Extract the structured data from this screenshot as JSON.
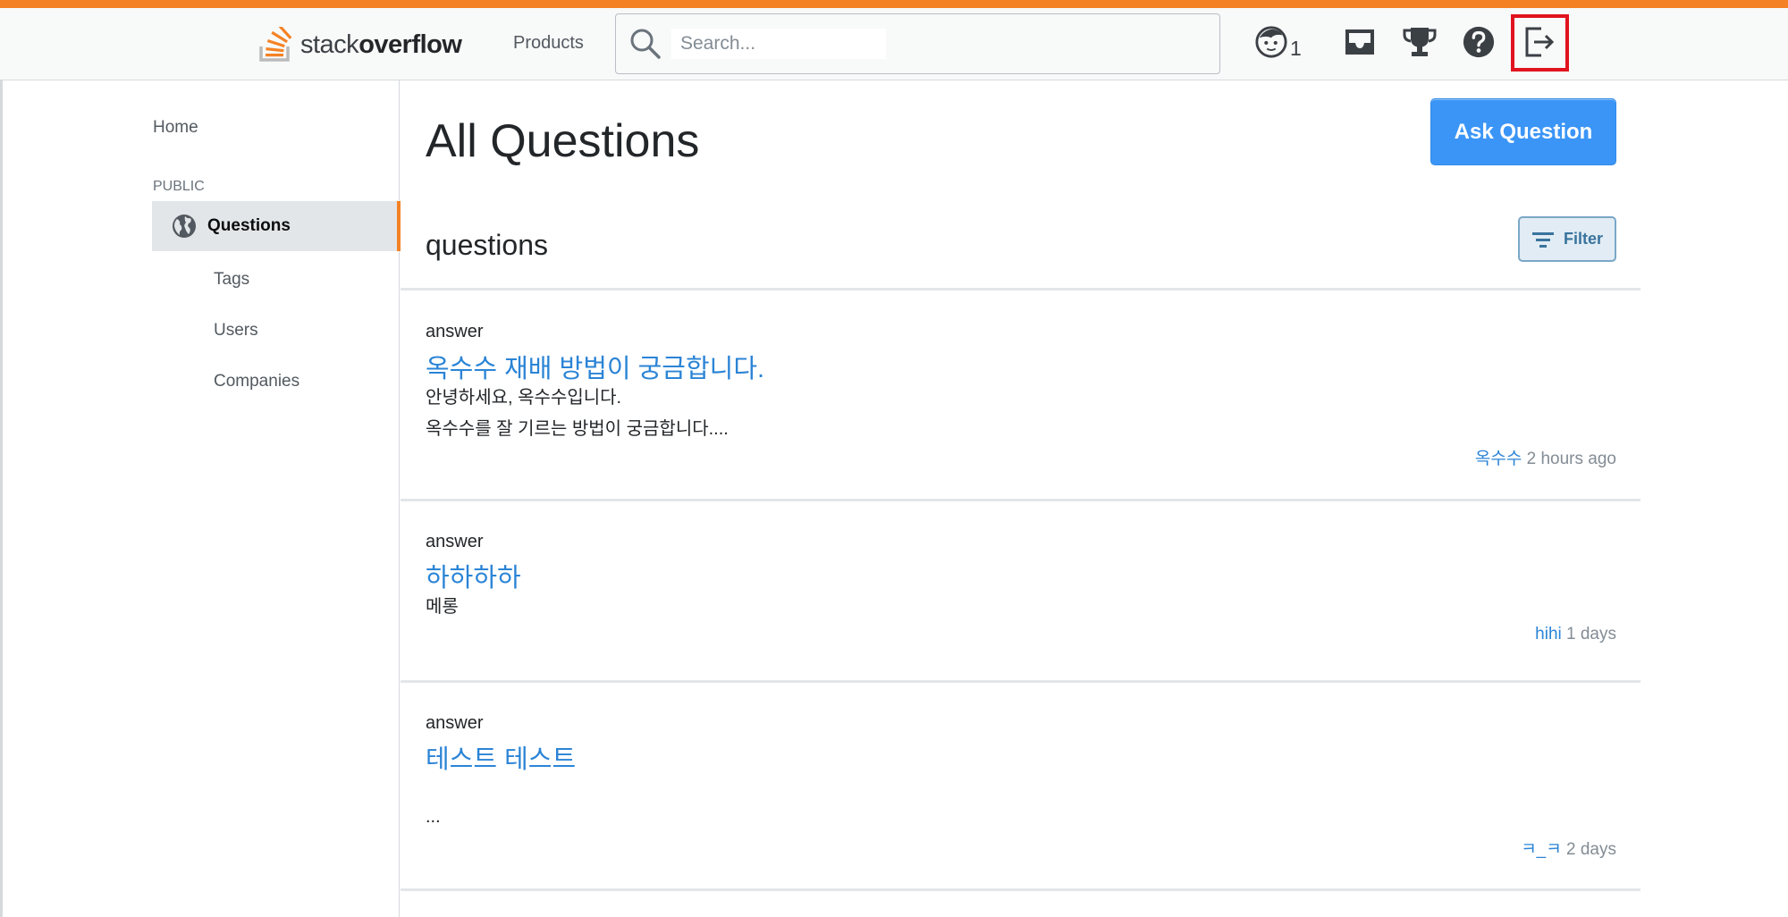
{
  "header": {
    "logo": {
      "light": "stack",
      "bold": "overflow"
    },
    "products_label": "Products",
    "search_placeholder": "Search...",
    "reputation": "1",
    "icons": [
      "user-avatar-icon",
      "inbox-icon",
      "trophy-icon",
      "help-icon",
      "logout-icon"
    ],
    "accent_color": "#f48225"
  },
  "sidebar": {
    "home": "Home",
    "section_label": "PUBLIC",
    "items": [
      {
        "label": "Questions",
        "active": true,
        "icon": "globe-icon"
      },
      {
        "label": "Tags"
      },
      {
        "label": "Users"
      },
      {
        "label": "Companies"
      }
    ]
  },
  "main": {
    "title": "All Questions",
    "ask_button": "Ask Question",
    "subtitle": "questions",
    "filter_button": "Filter",
    "questions": [
      {
        "status": "answer",
        "title": "옥수수 재배 방법이 궁금합니다.",
        "body_lines": [
          "안녕하세요, 옥수수입니다.",
          "옥수수를 잘 기르는 방법이 궁금합니다...."
        ],
        "author": "옥수수",
        "time": "2 hours ago"
      },
      {
        "status": "answer",
        "title": "하하하하",
        "body_lines": [
          "메롱"
        ],
        "author": "hihi",
        "time": "1 days"
      },
      {
        "status": "answer",
        "title": "테스트 테스트",
        "body_lines": [
          "..."
        ],
        "author": "ㅋ_ㅋ",
        "time": "2 days"
      }
    ]
  }
}
